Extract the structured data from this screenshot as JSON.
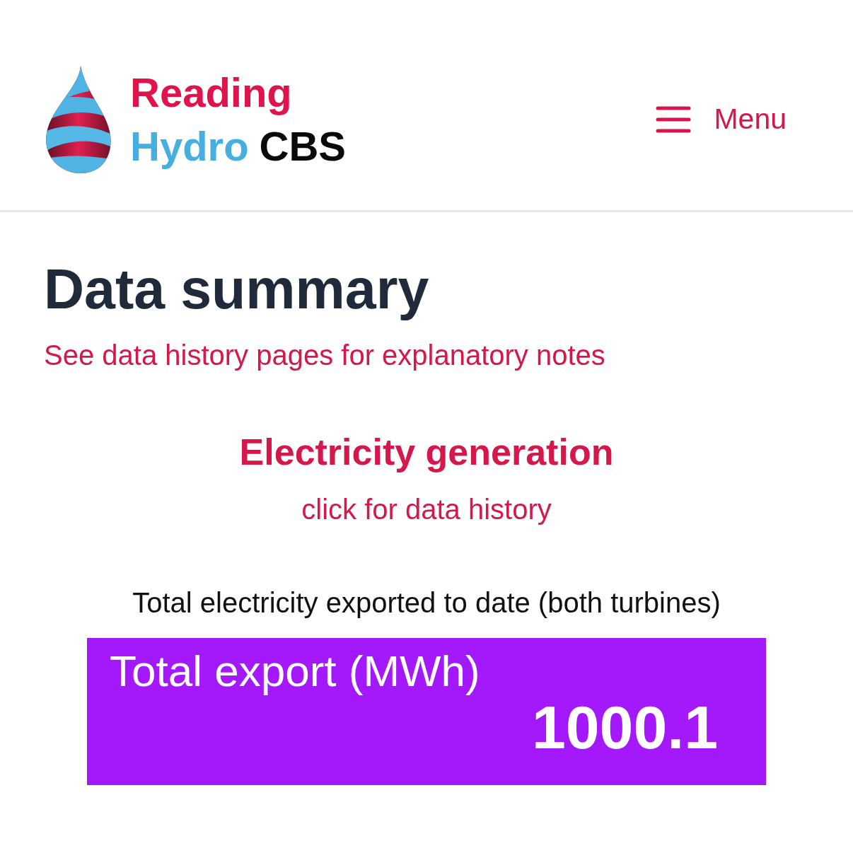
{
  "header": {
    "logo": {
      "line_1": "Reading",
      "line_2_word_1": "Hydro",
      "line_2_word_2": "CBS"
    },
    "menu_button": {
      "label": "Menu"
    }
  },
  "page": {
    "title": "Data summary",
    "note_link": "See data history pages for explanatory notes"
  },
  "section": {
    "title": "Electricity generation",
    "history_link": "click for data history",
    "caption": "Total electricity exported to date (both turbines)",
    "stat": {
      "label": "Total export (MWh)",
      "value": "1000.1"
    }
  }
}
